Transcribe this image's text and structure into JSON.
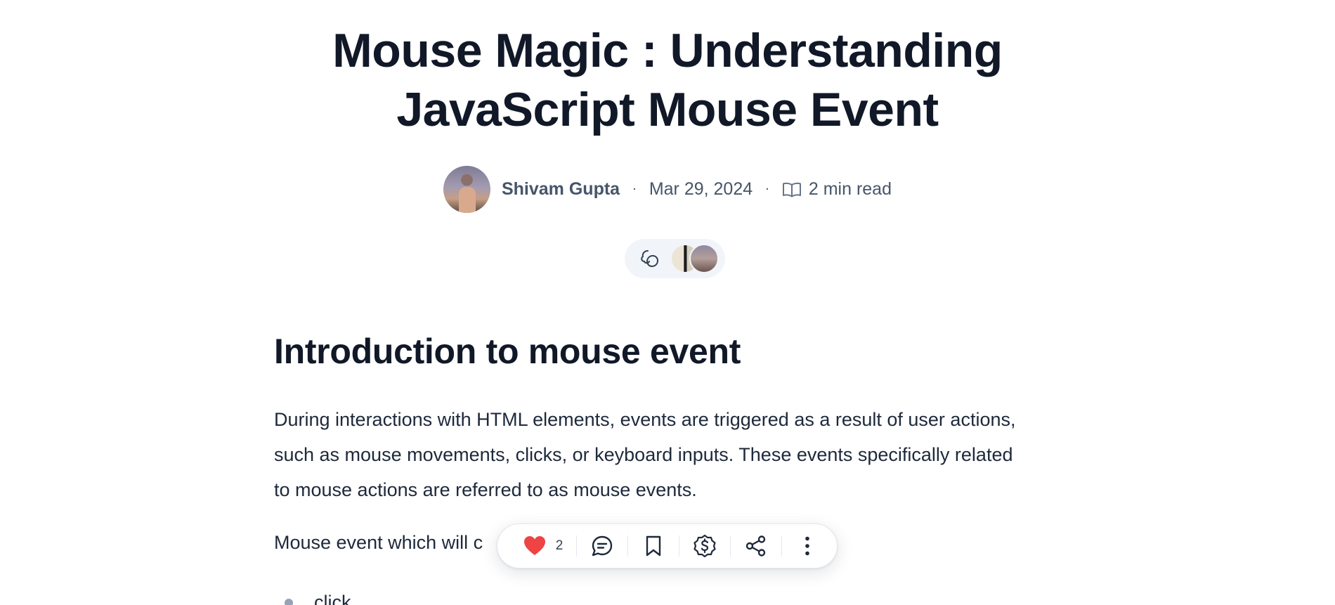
{
  "post": {
    "title_line1": "Mouse Magic : Understanding",
    "title_line2": "JavaScript Mouse Event",
    "author": "Shivam Gupta",
    "separator": "·",
    "date": "Mar 29, 2024",
    "read_time": "2 min read"
  },
  "article": {
    "heading": "Introduction to mouse event",
    "paragraph": "During interactions with HTML elements, events are triggered as a result of user actions, such as mouse movements, clicks, or keyboard inputs. These events specifically related to mouse actions are referred to as mouse events.",
    "paragraph2_visible": "Mouse event which will c",
    "list_item_1": "click"
  },
  "toolbar": {
    "like_count": "2",
    "icons": [
      "heart-icon",
      "comment-icon",
      "bookmark-icon",
      "dollar-icon",
      "share-icon",
      "more-icon"
    ]
  },
  "colors": {
    "title": "#111827",
    "meta": "#475569",
    "like": "#ef4444",
    "pill_bg": "#f1f5f9"
  }
}
